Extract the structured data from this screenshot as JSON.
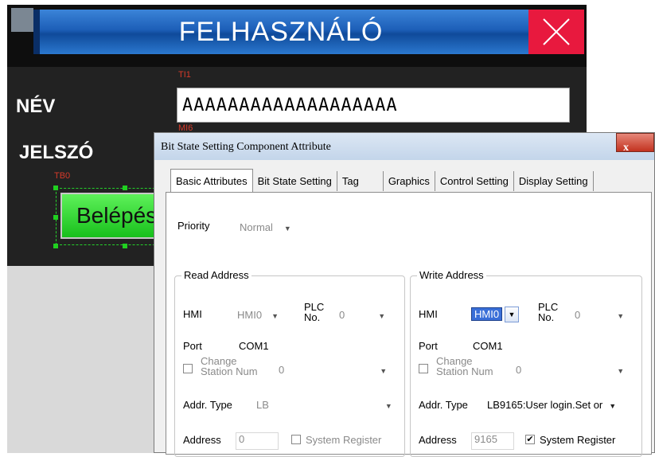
{
  "hmi": {
    "title": "FELHASZNÁLÓ",
    "name_label": "NÉV",
    "password_label": "JELSZÓ",
    "name_field_tag": "TI1",
    "password_field_tag": "MI6",
    "login_tag": "TB0",
    "name_value": "AAAAAAAAAAAAAAAAAAA",
    "login_button": "Belépés"
  },
  "dialog": {
    "title": "Bit State Setting Component Attribute",
    "close_label": "x",
    "tabs": [
      "Basic Attributes",
      "Bit State Setting",
      "Tag",
      "Graphics",
      "Control Setting",
      "Display Setting"
    ],
    "priority_label": "Priority",
    "priority_value": "Normal",
    "read": {
      "group_title": "Read Address",
      "hmi_label": "HMI",
      "hmi_value": "HMI0",
      "plc_label": "PLC",
      "plc_label2": "No.",
      "plc_value": "0",
      "port_label": "Port",
      "port_value": "COM1",
      "change_station": "Change",
      "change_station2": "Station Num",
      "station_value": "0",
      "addr_type_label": "Addr. Type",
      "addr_type_value": "LB",
      "address_label": "Address",
      "address_value": "0",
      "system_register": "System Register",
      "system_register_checked": false
    },
    "write": {
      "group_title": "Write Address",
      "hmi_label": "HMI",
      "hmi_value": "HMI0",
      "plc_label": "PLC",
      "plc_label2": "No.",
      "plc_value": "0",
      "port_label": "Port",
      "port_value": "COM1",
      "change_station": "Change",
      "change_station2": "Station Num",
      "station_value": "0",
      "addr_type_label": "Addr. Type",
      "addr_type_value": "LB9165:User login.Set or",
      "address_label": "Address",
      "address_value": "9165",
      "system_register": "System Register",
      "system_register_checked": true
    }
  },
  "colors": {
    "title_blue": "#1d5fb8",
    "close_red": "#e8193e",
    "login_green": "#18c01c",
    "dialog_bg": "#f0f0f0"
  }
}
